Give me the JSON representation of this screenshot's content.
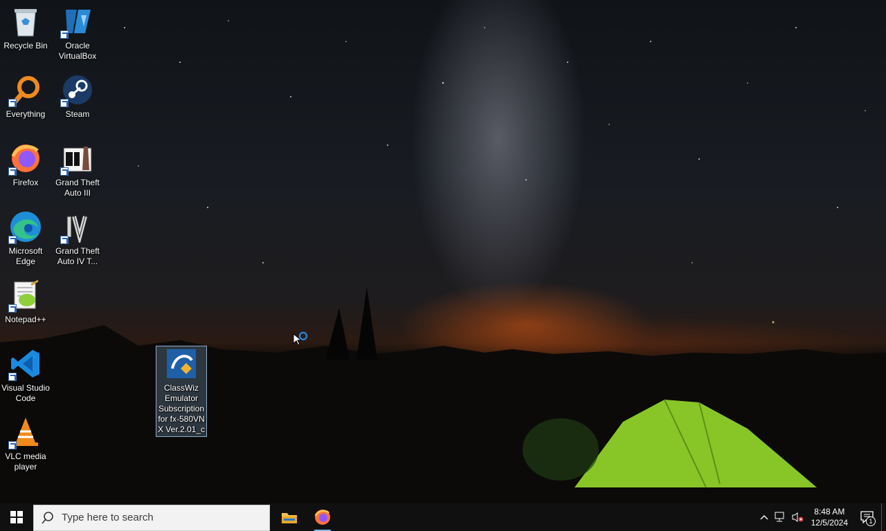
{
  "desktop": {
    "icons": [
      {
        "label": "Recycle Bin"
      },
      {
        "label": "Oracle VirtualBox"
      },
      {
        "label": "Everything"
      },
      {
        "label": "Steam"
      },
      {
        "label": "Firefox"
      },
      {
        "label": "Grand Theft Auto III"
      },
      {
        "label": "Microsoft Edge"
      },
      {
        "label": "Grand Theft Auto IV T..."
      },
      {
        "label": "Notepad++"
      },
      {
        "label": "Visual Studio Code"
      },
      {
        "label": "VLC media player"
      },
      {
        "label": "ClassWiz Emulator Subscription for fx-580VN X Ver.2.01_c"
      }
    ]
  },
  "taskbar": {
    "search_placeholder": "Type here to search",
    "time": "8:48 AM",
    "date": "12/5/2024",
    "notification_count": "1"
  },
  "colors": {
    "accent": "#76b9ed",
    "taskbar_bg": "#101010",
    "tent_green": "#8fd12a"
  }
}
